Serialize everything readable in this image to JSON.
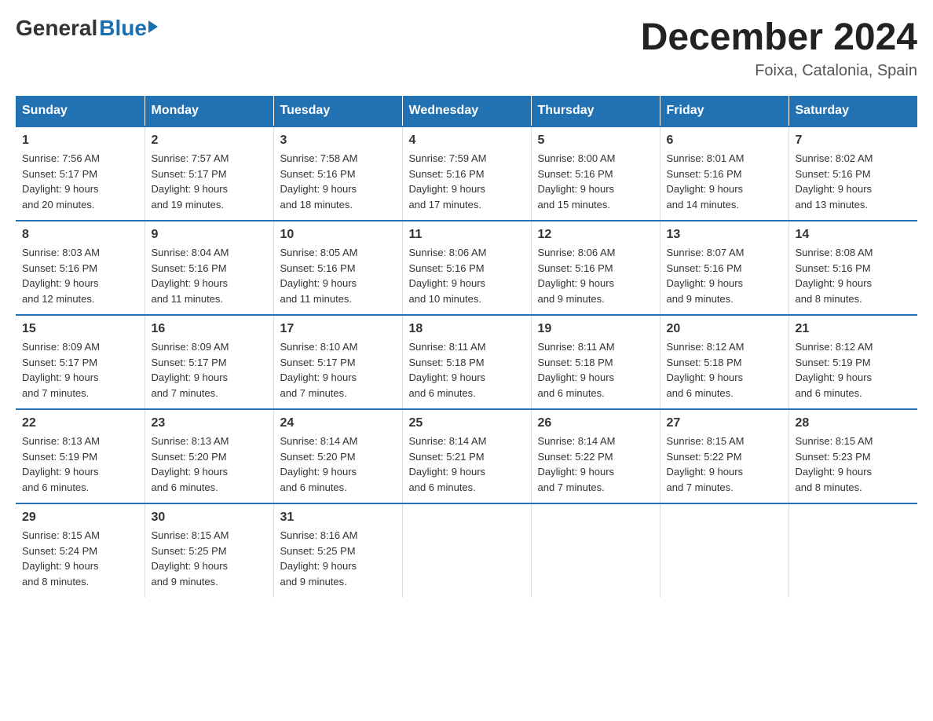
{
  "header": {
    "logo": {
      "general": "General",
      "blue": "Blue"
    },
    "title": "December 2024",
    "location": "Foixa, Catalonia, Spain"
  },
  "days_of_week": [
    "Sunday",
    "Monday",
    "Tuesday",
    "Wednesday",
    "Thursday",
    "Friday",
    "Saturday"
  ],
  "weeks": [
    [
      {
        "day": "1",
        "sunrise": "7:56 AM",
        "sunset": "5:17 PM",
        "daylight": "9 hours and 20 minutes."
      },
      {
        "day": "2",
        "sunrise": "7:57 AM",
        "sunset": "5:17 PM",
        "daylight": "9 hours and 19 minutes."
      },
      {
        "day": "3",
        "sunrise": "7:58 AM",
        "sunset": "5:16 PM",
        "daylight": "9 hours and 18 minutes."
      },
      {
        "day": "4",
        "sunrise": "7:59 AM",
        "sunset": "5:16 PM",
        "daylight": "9 hours and 17 minutes."
      },
      {
        "day": "5",
        "sunrise": "8:00 AM",
        "sunset": "5:16 PM",
        "daylight": "9 hours and 15 minutes."
      },
      {
        "day": "6",
        "sunrise": "8:01 AM",
        "sunset": "5:16 PM",
        "daylight": "9 hours and 14 minutes."
      },
      {
        "day": "7",
        "sunrise": "8:02 AM",
        "sunset": "5:16 PM",
        "daylight": "9 hours and 13 minutes."
      }
    ],
    [
      {
        "day": "8",
        "sunrise": "8:03 AM",
        "sunset": "5:16 PM",
        "daylight": "9 hours and 12 minutes."
      },
      {
        "day": "9",
        "sunrise": "8:04 AM",
        "sunset": "5:16 PM",
        "daylight": "9 hours and 11 minutes."
      },
      {
        "day": "10",
        "sunrise": "8:05 AM",
        "sunset": "5:16 PM",
        "daylight": "9 hours and 11 minutes."
      },
      {
        "day": "11",
        "sunrise": "8:06 AM",
        "sunset": "5:16 PM",
        "daylight": "9 hours and 10 minutes."
      },
      {
        "day": "12",
        "sunrise": "8:06 AM",
        "sunset": "5:16 PM",
        "daylight": "9 hours and 9 minutes."
      },
      {
        "day": "13",
        "sunrise": "8:07 AM",
        "sunset": "5:16 PM",
        "daylight": "9 hours and 9 minutes."
      },
      {
        "day": "14",
        "sunrise": "8:08 AM",
        "sunset": "5:16 PM",
        "daylight": "9 hours and 8 minutes."
      }
    ],
    [
      {
        "day": "15",
        "sunrise": "8:09 AM",
        "sunset": "5:17 PM",
        "daylight": "9 hours and 7 minutes."
      },
      {
        "day": "16",
        "sunrise": "8:09 AM",
        "sunset": "5:17 PM",
        "daylight": "9 hours and 7 minutes."
      },
      {
        "day": "17",
        "sunrise": "8:10 AM",
        "sunset": "5:17 PM",
        "daylight": "9 hours and 7 minutes."
      },
      {
        "day": "18",
        "sunrise": "8:11 AM",
        "sunset": "5:18 PM",
        "daylight": "9 hours and 6 minutes."
      },
      {
        "day": "19",
        "sunrise": "8:11 AM",
        "sunset": "5:18 PM",
        "daylight": "9 hours and 6 minutes."
      },
      {
        "day": "20",
        "sunrise": "8:12 AM",
        "sunset": "5:18 PM",
        "daylight": "9 hours and 6 minutes."
      },
      {
        "day": "21",
        "sunrise": "8:12 AM",
        "sunset": "5:19 PM",
        "daylight": "9 hours and 6 minutes."
      }
    ],
    [
      {
        "day": "22",
        "sunrise": "8:13 AM",
        "sunset": "5:19 PM",
        "daylight": "9 hours and 6 minutes."
      },
      {
        "day": "23",
        "sunrise": "8:13 AM",
        "sunset": "5:20 PM",
        "daylight": "9 hours and 6 minutes."
      },
      {
        "day": "24",
        "sunrise": "8:14 AM",
        "sunset": "5:20 PM",
        "daylight": "9 hours and 6 minutes."
      },
      {
        "day": "25",
        "sunrise": "8:14 AM",
        "sunset": "5:21 PM",
        "daylight": "9 hours and 6 minutes."
      },
      {
        "day": "26",
        "sunrise": "8:14 AM",
        "sunset": "5:22 PM",
        "daylight": "9 hours and 7 minutes."
      },
      {
        "day": "27",
        "sunrise": "8:15 AM",
        "sunset": "5:22 PM",
        "daylight": "9 hours and 7 minutes."
      },
      {
        "day": "28",
        "sunrise": "8:15 AM",
        "sunset": "5:23 PM",
        "daylight": "9 hours and 8 minutes."
      }
    ],
    [
      {
        "day": "29",
        "sunrise": "8:15 AM",
        "sunset": "5:24 PM",
        "daylight": "9 hours and 8 minutes."
      },
      {
        "day": "30",
        "sunrise": "8:15 AM",
        "sunset": "5:25 PM",
        "daylight": "9 hours and 9 minutes."
      },
      {
        "day": "31",
        "sunrise": "8:16 AM",
        "sunset": "5:25 PM",
        "daylight": "9 hours and 9 minutes."
      },
      null,
      null,
      null,
      null
    ]
  ]
}
